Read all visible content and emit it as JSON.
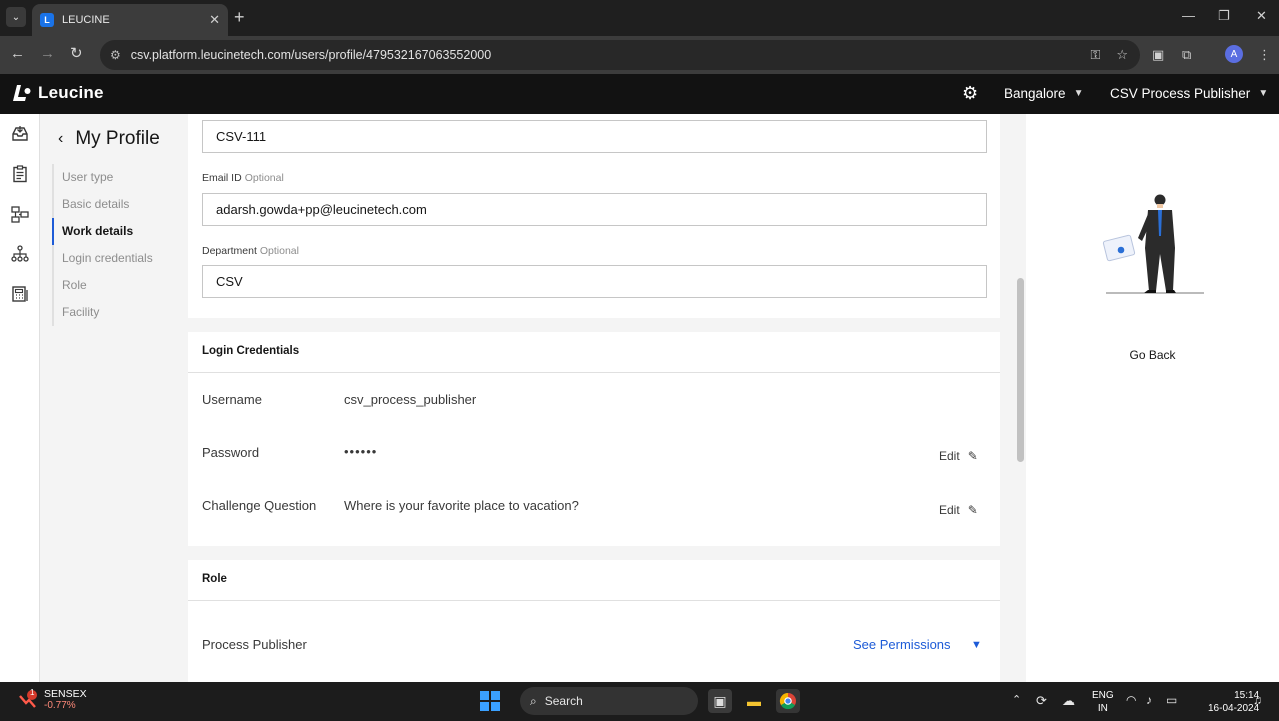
{
  "browser": {
    "tab_title": "LEUCINE",
    "url": "csv.platform.leucinetech.com/users/profile/479532167063552000",
    "profile_initial": "A",
    "new_tab": "+",
    "close_tab": "✕"
  },
  "header": {
    "brand": "Leucine",
    "facility": "Bangalore",
    "user_role": "CSV Process Publisher"
  },
  "profile_nav": {
    "title": "My Profile",
    "items": [
      {
        "label": "User type"
      },
      {
        "label": "Basic details"
      },
      {
        "label": "Work details",
        "active": true
      },
      {
        "label": "Login credentials"
      },
      {
        "label": "Role"
      },
      {
        "label": "Facility"
      }
    ]
  },
  "work_details": {
    "employee_id_value": "CSV-111",
    "email": {
      "label": "Email ID",
      "optional": "Optional",
      "value": "adarsh.gowda+pp@leucinetech.com"
    },
    "department": {
      "label": "Department",
      "optional": "Optional",
      "value": "CSV"
    }
  },
  "login_credentials": {
    "title": "Login Credentials",
    "username_label": "Username",
    "username_value": "csv_process_publisher",
    "password_label": "Password",
    "password_value": "••••••",
    "challenge_label": "Challenge Question",
    "challenge_value": "Where is your favorite place to vacation?",
    "edit_label": "Edit"
  },
  "role": {
    "title": "Role",
    "name": "Process Publisher",
    "see_permissions": "See Permissions"
  },
  "right_panel": {
    "go_back": "Go Back"
  },
  "taskbar": {
    "ticker_name": "SENSEX",
    "ticker_change": "-0.77%",
    "ticker_badge": "1",
    "search": "Search",
    "lang_top": "ENG",
    "lang_bottom": "IN",
    "time": "15:14",
    "date": "16-04-2024"
  },
  "colors": {
    "accent": "#1d5bd7",
    "header_bg": "#121212"
  }
}
